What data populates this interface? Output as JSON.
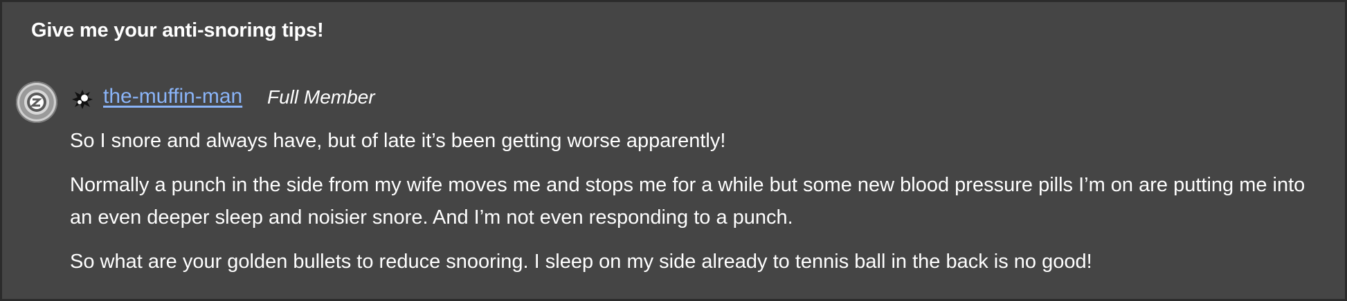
{
  "topic": {
    "title": "Give me your anti-snoring tips!"
  },
  "post": {
    "author": {
      "username": "the-muffin-man",
      "rank": "Full Member",
      "avatar_icon": "sleep-badge-icon",
      "flair_icon": "splat-icon"
    },
    "paragraphs": [
      "So I snore and always have, but of late it’s been getting worse apparently!",
      "Normally a punch in the side from my wife moves me and stops me for a while but some new blood pressure pills I’m on are putting me into an even deeper sleep and noisier snore. And I’m not even responding to a punch.",
      "So what are your golden bullets to reduce snooring. I sleep on my side already to tennis ball in the back is no good!"
    ]
  },
  "colors": {
    "page_background": "#2b2b2b",
    "panel_background": "#454545",
    "text": "#ffffff",
    "link": "#8ab4f8"
  }
}
